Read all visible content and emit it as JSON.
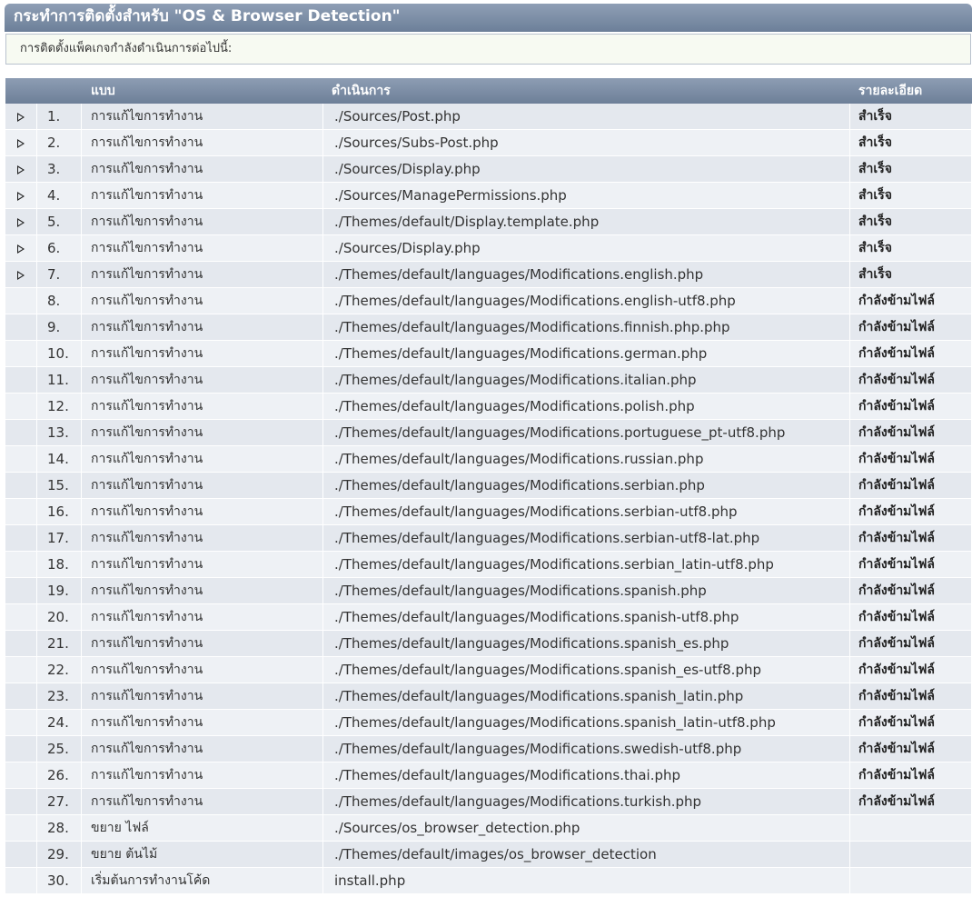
{
  "header": {
    "title": "กระทำการติดตั้งสำหรับ \"OS & Browser Detection\""
  },
  "info": {
    "text": "การติดตั้งแพ็คเกจกำลังดำเนินการต่อไปนี้:"
  },
  "table": {
    "columns": [
      "แบบ",
      "ดำเนินการ",
      "รายละเอียด"
    ],
    "rows": [
      {
        "expandable": true,
        "num": "1.",
        "type": "การแก้ไขการทำงาน",
        "file": "./Sources/Post.php",
        "detail": "สำเร็จ"
      },
      {
        "expandable": true,
        "num": "2.",
        "type": "การแก้ไขการทำงาน",
        "file": "./Sources/Subs-Post.php",
        "detail": "สำเร็จ"
      },
      {
        "expandable": true,
        "num": "3.",
        "type": "การแก้ไขการทำงาน",
        "file": "./Sources/Display.php",
        "detail": "สำเร็จ"
      },
      {
        "expandable": true,
        "num": "4.",
        "type": "การแก้ไขการทำงาน",
        "file": "./Sources/ManagePermissions.php",
        "detail": "สำเร็จ"
      },
      {
        "expandable": true,
        "num": "5.",
        "type": "การแก้ไขการทำงาน",
        "file": "./Themes/default/Display.template.php",
        "detail": "สำเร็จ"
      },
      {
        "expandable": true,
        "num": "6.",
        "type": "การแก้ไขการทำงาน",
        "file": "./Sources/Display.php",
        "detail": "สำเร็จ"
      },
      {
        "expandable": true,
        "num": "7.",
        "type": "การแก้ไขการทำงาน",
        "file": "./Themes/default/languages/Modifications.english.php",
        "detail": "สำเร็จ"
      },
      {
        "expandable": false,
        "num": "8.",
        "type": "การแก้ไขการทำงาน",
        "file": "./Themes/default/languages/Modifications.english-utf8.php",
        "detail": "กำลังข้ามไฟล์"
      },
      {
        "expandable": false,
        "num": "9.",
        "type": "การแก้ไขการทำงาน",
        "file": "./Themes/default/languages/Modifications.finnish.php.php",
        "detail": "กำลังข้ามไฟล์"
      },
      {
        "expandable": false,
        "num": "10.",
        "type": "การแก้ไขการทำงาน",
        "file": "./Themes/default/languages/Modifications.german.php",
        "detail": "กำลังข้ามไฟล์"
      },
      {
        "expandable": false,
        "num": "11.",
        "type": "การแก้ไขการทำงาน",
        "file": "./Themes/default/languages/Modifications.italian.php",
        "detail": "กำลังข้ามไฟล์"
      },
      {
        "expandable": false,
        "num": "12.",
        "type": "การแก้ไขการทำงาน",
        "file": "./Themes/default/languages/Modifications.polish.php",
        "detail": "กำลังข้ามไฟล์"
      },
      {
        "expandable": false,
        "num": "13.",
        "type": "การแก้ไขการทำงาน",
        "file": "./Themes/default/languages/Modifications.portuguese_pt-utf8.php",
        "detail": "กำลังข้ามไฟล์"
      },
      {
        "expandable": false,
        "num": "14.",
        "type": "การแก้ไขการทำงาน",
        "file": "./Themes/default/languages/Modifications.russian.php",
        "detail": "กำลังข้ามไฟล์"
      },
      {
        "expandable": false,
        "num": "15.",
        "type": "การแก้ไขการทำงาน",
        "file": "./Themes/default/languages/Modifications.serbian.php",
        "detail": "กำลังข้ามไฟล์"
      },
      {
        "expandable": false,
        "num": "16.",
        "type": "การแก้ไขการทำงาน",
        "file": "./Themes/default/languages/Modifications.serbian-utf8.php",
        "detail": "กำลังข้ามไฟล์"
      },
      {
        "expandable": false,
        "num": "17.",
        "type": "การแก้ไขการทำงาน",
        "file": "./Themes/default/languages/Modifications.serbian-utf8-lat.php",
        "detail": "กำลังข้ามไฟล์"
      },
      {
        "expandable": false,
        "num": "18.",
        "type": "การแก้ไขการทำงาน",
        "file": "./Themes/default/languages/Modifications.serbian_latin-utf8.php",
        "detail": "กำลังข้ามไฟล์"
      },
      {
        "expandable": false,
        "num": "19.",
        "type": "การแก้ไขการทำงาน",
        "file": "./Themes/default/languages/Modifications.spanish.php",
        "detail": "กำลังข้ามไฟล์"
      },
      {
        "expandable": false,
        "num": "20.",
        "type": "การแก้ไขการทำงาน",
        "file": "./Themes/default/languages/Modifications.spanish-utf8.php",
        "detail": "กำลังข้ามไฟล์"
      },
      {
        "expandable": false,
        "num": "21.",
        "type": "การแก้ไขการทำงาน",
        "file": "./Themes/default/languages/Modifications.spanish_es.php",
        "detail": "กำลังข้ามไฟล์"
      },
      {
        "expandable": false,
        "num": "22.",
        "type": "การแก้ไขการทำงาน",
        "file": "./Themes/default/languages/Modifications.spanish_es-utf8.php",
        "detail": "กำลังข้ามไฟล์"
      },
      {
        "expandable": false,
        "num": "23.",
        "type": "การแก้ไขการทำงาน",
        "file": "./Themes/default/languages/Modifications.spanish_latin.php",
        "detail": "กำลังข้ามไฟล์"
      },
      {
        "expandable": false,
        "num": "24.",
        "type": "การแก้ไขการทำงาน",
        "file": "./Themes/default/languages/Modifications.spanish_latin-utf8.php",
        "detail": "กำลังข้ามไฟล์"
      },
      {
        "expandable": false,
        "num": "25.",
        "type": "การแก้ไขการทำงาน",
        "file": "./Themes/default/languages/Modifications.swedish-utf8.php",
        "detail": "กำลังข้ามไฟล์"
      },
      {
        "expandable": false,
        "num": "26.",
        "type": "การแก้ไขการทำงาน",
        "file": "./Themes/default/languages/Modifications.thai.php",
        "detail": "กำลังข้ามไฟล์"
      },
      {
        "expandable": false,
        "num": "27.",
        "type": "การแก้ไขการทำงาน",
        "file": "./Themes/default/languages/Modifications.turkish.php",
        "detail": "กำลังข้ามไฟล์"
      },
      {
        "expandable": false,
        "num": "28.",
        "type": "ขยาย ไฟล์",
        "file": "./Sources/os_browser_detection.php",
        "detail": ""
      },
      {
        "expandable": false,
        "num": "29.",
        "type": "ขยาย ต้นไม้",
        "file": "./Themes/default/images/os_browser_detection",
        "detail": ""
      },
      {
        "expandable": false,
        "num": "30.",
        "type": "เริ่มต้นการทำงานโค้ด",
        "file": "install.php",
        "detail": ""
      }
    ]
  }
}
